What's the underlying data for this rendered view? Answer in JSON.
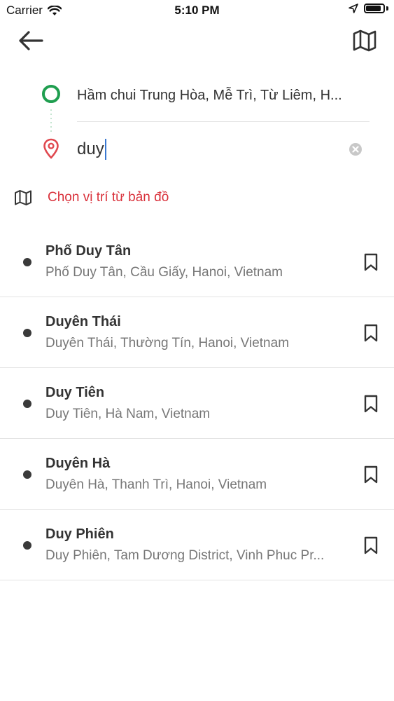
{
  "status_bar": {
    "carrier": "Carrier",
    "time": "5:10 PM",
    "battery_level": 0.9,
    "icons": [
      "wifi-icon",
      "location-arrow-icon",
      "battery-icon"
    ]
  },
  "nav": {
    "back_icon": "arrow-left-icon",
    "map_icon": "map-icon"
  },
  "route": {
    "origin_value": "Hầm chui Trung Hòa, Mễ Trì, Từ Liêm, H...",
    "destination_value": "duy",
    "origin_color": "#1f9e4f",
    "destination_color": "#e0484f"
  },
  "choose_map": {
    "label": "Chọn vị trí từ bản đồ",
    "color": "#d9313b"
  },
  "results": [
    {
      "title": "Phố Duy Tân",
      "subtitle": "Phố Duy Tân, Cầu Giấy, Hanoi, Vietnam"
    },
    {
      "title": "Duyên Thái",
      "subtitle": "Duyên Thái, Thường Tín, Hanoi, Vietnam"
    },
    {
      "title": "Duy Tiên",
      "subtitle": "Duy Tiên, Hà Nam, Vietnam"
    },
    {
      "title": "Duyên Hà",
      "subtitle": "Duyên Hà, Thanh Trì, Hanoi, Vietnam"
    },
    {
      "title": "Duy Phiên",
      "subtitle": "Duy Phiên, Tam Dương District, Vinh Phuc Pr..."
    }
  ]
}
